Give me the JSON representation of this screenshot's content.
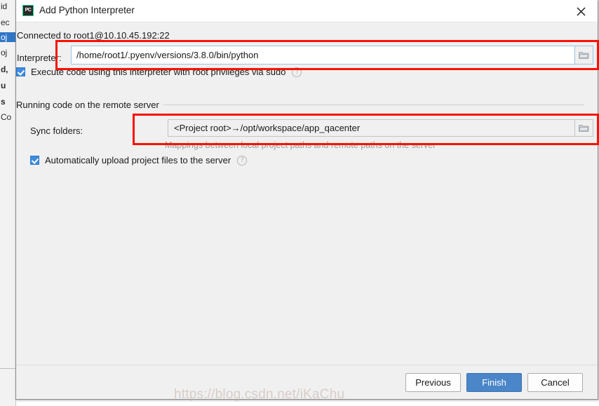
{
  "window": {
    "title": "Add Python Interpreter",
    "app_icon": "pycharm-icon",
    "icon_text": "PC",
    "close_label": "✕"
  },
  "content": {
    "connected_text": "Connected to root1@10.10.45.192:22",
    "interpreter_label": "Interpreter:",
    "interpreter_value": "/home/root1/.pyenv/versions/3.8.0/bin/python",
    "sudo_checkbox": {
      "label": "Execute code using this interpreter with root privileges via sudo",
      "checked": true,
      "help": "?"
    },
    "group_label": "Running code on the remote server",
    "sync_folders_label": "Sync folders:",
    "sync_folders_value": "<Project root>→/opt/workspace/app_qacenter",
    "sync_folders_hint": "Mappings between local project paths and remote paths on the server",
    "upload_checkbox": {
      "label": "Automatically upload project files to the server",
      "checked": true,
      "help": "?"
    }
  },
  "buttons": {
    "previous": "Previous",
    "finish": "Finish",
    "cancel": "Cancel"
  },
  "annotations": {
    "highlight_color": "#fb1102",
    "accent_color": "#4a86c8",
    "watermark": "https://blog.csdn.net/iKaChu"
  },
  "background": {
    "fragments": [
      "id",
      "ec",
      "oj",
      "oj",
      "d,",
      "u",
      "s",
      "Co"
    ]
  }
}
